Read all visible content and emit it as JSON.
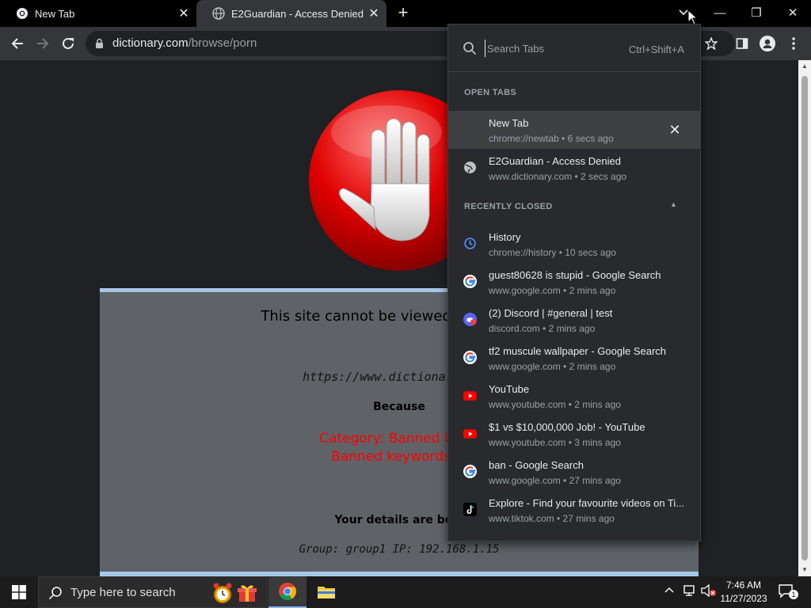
{
  "tabs": [
    {
      "title": "New Tab",
      "close": "✕"
    },
    {
      "title": "E2Guardian - Access Denied",
      "close": "✕"
    }
  ],
  "new_tab_symbol": "+",
  "window_controls": {
    "minimize": "—",
    "restore": "❐",
    "close": "✕"
  },
  "omnibox": {
    "host": "dictionary.com",
    "path": "/browse/porn"
  },
  "blocked_page": {
    "title": "This site cannot be viewed at this time",
    "url": "https://www.dictionary.com/",
    "because": "Because",
    "reason_line1": "Category: Banned URL l",
    "reason_line2": "Banned keywords in",
    "details_label": "Your details are belo",
    "details": "Group: group1   IP: 192.168.1.15"
  },
  "tab_search": {
    "placeholder": "Search Tabs",
    "shortcut": "Ctrl+Shift+A",
    "open_tabs_header": "OPEN TABS",
    "recently_closed_header": "RECENTLY CLOSED",
    "open_tabs": [
      {
        "title": "New Tab",
        "sub": "chrome://newtab • 6 secs ago",
        "icon": "blank"
      },
      {
        "title": "E2Guardian - Access Denied",
        "sub": "www.dictionary.com • 2 secs ago",
        "icon": "globe"
      }
    ],
    "recently_closed": [
      {
        "title": "History",
        "sub": "chrome://history • 10 secs ago",
        "icon": "history"
      },
      {
        "title": "guest80628 is stupid - Google Search",
        "sub": "www.google.com • 2 mins ago",
        "icon": "google"
      },
      {
        "title": "(2) Discord | #general | test",
        "sub": "discord.com • 2 mins ago",
        "icon": "discord"
      },
      {
        "title": "tf2 muscule wallpaper - Google Search",
        "sub": "www.google.com • 2 mins ago",
        "icon": "google"
      },
      {
        "title": "YouTube",
        "sub": "www.youtube.com • 2 mins ago",
        "icon": "youtube"
      },
      {
        "title": "$1 vs $10,000,000 Job! - YouTube",
        "sub": "www.youtube.com • 3 mins ago",
        "icon": "youtube"
      },
      {
        "title": "ban - Google Search",
        "sub": "www.google.com • 27 mins ago",
        "icon": "google"
      },
      {
        "title": "Explore - Find your favourite videos on Ti...",
        "sub": "www.tiktok.com • 27 mins ago",
        "icon": "tiktok"
      }
    ]
  },
  "taskbar": {
    "search_placeholder": "Type here to search",
    "time": "7:46 AM",
    "date": "11/27/2023",
    "notification_count": "1"
  },
  "colors": {
    "tabstrip": "#000000",
    "toolbar": "#35363a",
    "page_bg": "#202124",
    "card_bg": "#5f6368",
    "card_border": "#a7c7e7",
    "reason_red": "#ff0000",
    "dropdown_bg": "#292a2d"
  }
}
